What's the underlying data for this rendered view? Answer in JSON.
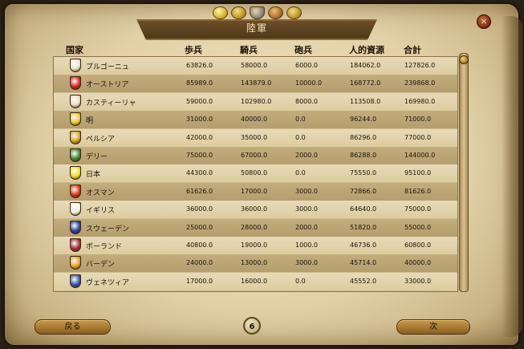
{
  "window": {
    "title": "陸軍",
    "close_glyph": "×"
  },
  "top_icons": [
    "crown-icon",
    "helmet-icon",
    "shield-icon",
    "ship-icon",
    "scroll-icon"
  ],
  "columns": {
    "country": "国家",
    "infantry": "歩兵",
    "cavalry": "騎兵",
    "artillery": "砲兵",
    "manpower": "人的資源",
    "total": "合計"
  },
  "rows": [
    {
      "name": "ブルゴーニュ",
      "infantry": "63826.0",
      "cavalry": "58000.0",
      "artillery": "6000.0",
      "manpower": "184062.0",
      "total": "127826.0",
      "color": "#e8e0d0"
    },
    {
      "name": "オーストリア",
      "infantry": "85989.0",
      "cavalry": "143879.0",
      "artillery": "10000.0",
      "manpower": "168772.0",
      "total": "239868.0",
      "color": "#d8231e"
    },
    {
      "name": "カスティーリャ",
      "infantry": "59000.0",
      "cavalry": "102980.0",
      "artillery": "8000.0",
      "manpower": "113508.0",
      "total": "169980.0",
      "color": "#e9d9c0"
    },
    {
      "name": "明",
      "infantry": "31000.0",
      "cavalry": "40000.0",
      "artillery": "0.0",
      "manpower": "96244.0",
      "total": "71000.0",
      "color": "#e8c832"
    },
    {
      "name": "ペルシア",
      "infantry": "42000.0",
      "cavalry": "35000.0",
      "artillery": "0.0",
      "manpower": "86296.0",
      "total": "77000.0",
      "color": "#d6a020"
    },
    {
      "name": "デリー",
      "infantry": "75000.0",
      "cavalry": "67000.0",
      "artillery": "2000.0",
      "manpower": "86288.0",
      "total": "144000.0",
      "color": "#3a8a2a"
    },
    {
      "name": "日本",
      "infantry": "44300.0",
      "cavalry": "50800.0",
      "artillery": "0.0",
      "manpower": "75550.0",
      "total": "95100.0",
      "color": "#f0e020"
    },
    {
      "name": "オスマン",
      "infantry": "61626.0",
      "cavalry": "17000.0",
      "artillery": "3000.0",
      "manpower": "72866.0",
      "total": "81626.0",
      "color": "#e03010"
    },
    {
      "name": "イギリス",
      "infantry": "36000.0",
      "cavalry": "36000.0",
      "artillery": "3000.0",
      "manpower": "64640.0",
      "total": "75000.0",
      "color": "#f2eee8"
    },
    {
      "name": "スウェーデン",
      "infantry": "25000.0",
      "cavalry": "28000.0",
      "artillery": "2000.0",
      "manpower": "51820.0",
      "total": "55000.0",
      "color": "#2040a8"
    },
    {
      "name": "ポーランド",
      "infantry": "40800.0",
      "cavalry": "19000.0",
      "artillery": "1000.0",
      "manpower": "46736.0",
      "total": "60800.0",
      "color": "#b02838"
    },
    {
      "name": "バーデン",
      "infantry": "24000.0",
      "cavalry": "13000.0",
      "artillery": "3000.0",
      "manpower": "45714.0",
      "total": "40000.0",
      "color": "#e8a020"
    },
    {
      "name": "ヴェネツィア",
      "infantry": "17000.0",
      "cavalry": "16000.0",
      "artillery": "0.0",
      "manpower": "45552.0",
      "total": "33000.0",
      "color": "#2a58b8"
    }
  ],
  "footer": {
    "back_label": "戻る",
    "page": "6",
    "next_label": "次"
  }
}
